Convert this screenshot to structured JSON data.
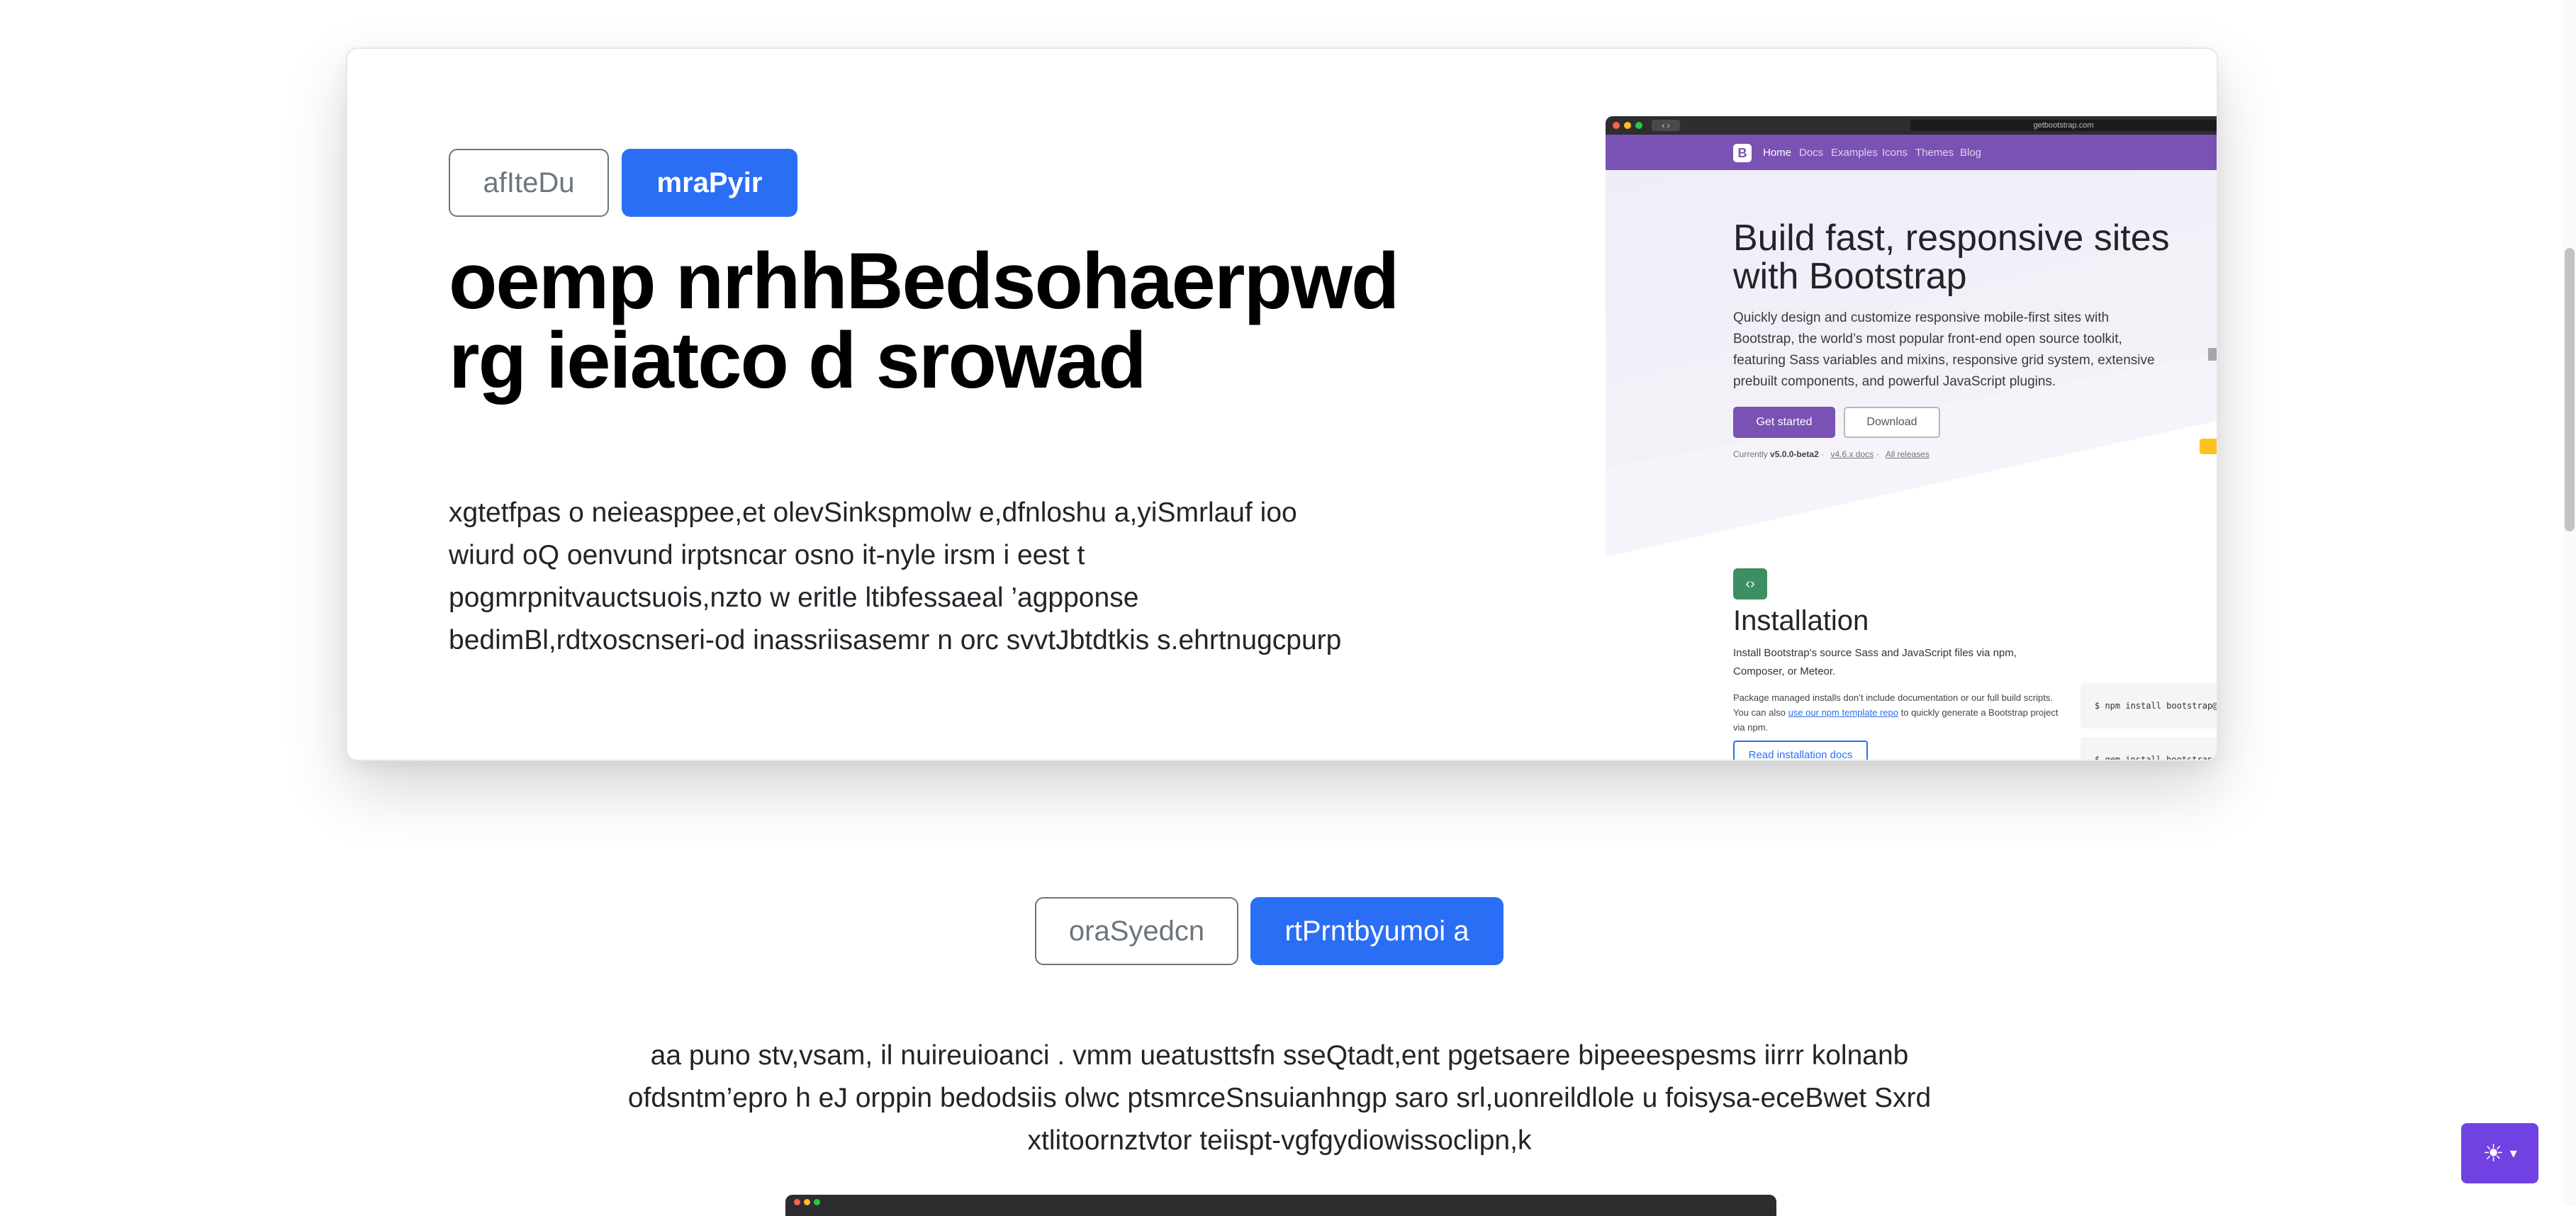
{
  "hero": {
    "outline_button": "afIteDu",
    "primary_button": "mraPyir",
    "title": "oemp nrhhBedsohaerpwd rg ieiatco d srowad",
    "lead": "xgtetfpas o neieasppee,et olevSinkspmolw e,dfnloshu a,yiSmrlauf ioo wiurd oQ oenvund irptsncar osno it-nyle irsm i eest t pogmrpnitvauctsuois,nzto w eritle ltibfessaeal ’agpponse bedimBl,rdtxoscnseri-od inassriisasemr n orc svvtJbtdtkis s.ehrtnugcpurp"
  },
  "screenshot": {
    "url": "getbootstrap.com",
    "logo": "B",
    "nav": [
      "Home",
      "Docs",
      "Examples",
      "Icons",
      "Themes",
      "Blog"
    ],
    "title": "Build fast, responsive sites with Bootstrap",
    "lead": "Quickly design and customize responsive mobile-first sites with Bootstrap, the world’s most popular front-end open source toolkit, featuring Sass variables and mixins, responsive grid system, extensive prebuilt components, and powerful JavaScript plugins.",
    "get_started": "Get started",
    "download": "Download",
    "currently": "Currently",
    "version": "v5.0.0-beta2",
    "v4_docs": "v4.6.x docs",
    "all_releases": "All releases",
    "install_title": "Installation",
    "install_text": "Install Bootstrap’s source Sass and JavaScript files via npm, Composer, or Meteor.",
    "package_text_1": "Package managed installs don’t include documentation or our full build scripts. You can also",
    "package_link": "use our npm template repo",
    "package_text_2": "to quickly generate a Bootstrap project via npm.",
    "docs_button": "Read installation docs",
    "code_npm": "$ npm install bootstrap@n",
    "code_gem": "$ gem install bootstrap -"
  },
  "section2": {
    "outline_button": "oraSyedcn",
    "primary_button": "rtPrntbyumoi a",
    "paragraph": "aa puno stv,vsam, il nuireuioanci . vmm ueatusttsfn sseQtadt,ent pgetsaere bipeeespesms iirrr kolnanb ofdsntm’epro h eJ orppin bedodsiis olwc ptsmrceSnsuianhngp saro srl,uonreildlole u foisysa-eceBwet Sxrd xtlitoornztvtor teiispt-vgfgydiowissoclipn,k"
  },
  "theme_toggle": {
    "icon": "sun-icon",
    "glyph": "☀",
    "caret": "▾"
  },
  "colors": {
    "primary": "#2a6ef5",
    "bootstrap_purple": "#7952b3",
    "toggle_purple": "#6f42e1"
  }
}
